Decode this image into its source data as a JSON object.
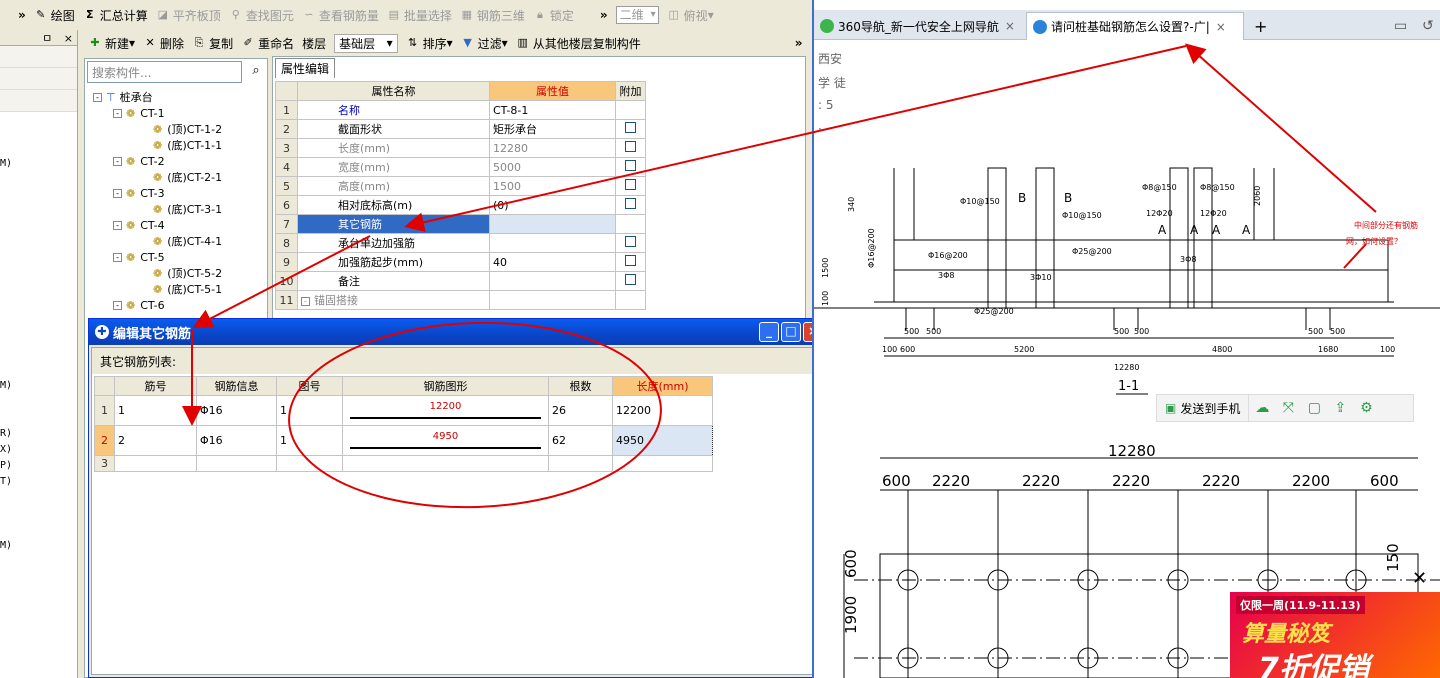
{
  "app": {
    "toolbar1": {
      "chevron": "»",
      "draw": "绘图",
      "sum": "汇总计算",
      "flat_slab": "平齐板顶",
      "find_elem": "查找图元",
      "view_rebar": "查看钢筋量",
      "batch_select": "批量选择",
      "rebar_3d": "钢筋三维",
      "lock": "锁定",
      "chevron2": "»",
      "view2d": "二维",
      "top_view": "俯视"
    },
    "toolbar2": {
      "chevron": "»",
      "new": "新建",
      "delete": "删除",
      "copy": "复制",
      "rename": "重命名",
      "floor_label": "楼层",
      "floor_value": "基础层",
      "sort": "排序",
      "filter": "过滤",
      "copy_from_floor": "从其他楼层复制构件",
      "chevron2": "»"
    },
    "left_panel": {
      "pin": "ㅁ",
      "close": "×",
      "frags": [
        "M)",
        "M)",
        "R)",
        "X)",
        "P)",
        "T)",
        "M)"
      ]
    },
    "tree": {
      "search_placeholder": "搜索构件...",
      "root": "桩承台",
      "items": [
        {
          "label": "CT-1",
          "level": 1,
          "toggle": "-"
        },
        {
          "label": "(顶)CT-1-2",
          "level": 2
        },
        {
          "label": "(底)CT-1-1",
          "level": 2
        },
        {
          "label": "CT-2",
          "level": 1,
          "toggle": "-"
        },
        {
          "label": "(底)CT-2-1",
          "level": 2
        },
        {
          "label": "CT-3",
          "level": 1,
          "toggle": "-"
        },
        {
          "label": "(底)CT-3-1",
          "level": 2
        },
        {
          "label": "CT-4",
          "level": 1,
          "toggle": "-"
        },
        {
          "label": "(底)CT-4-1",
          "level": 2
        },
        {
          "label": "CT-5",
          "level": 1,
          "toggle": "-"
        },
        {
          "label": "(顶)CT-5-2",
          "level": 2
        },
        {
          "label": "(底)CT-5-1",
          "level": 2
        },
        {
          "label": "CT-6",
          "level": 1,
          "toggle": "-"
        }
      ]
    },
    "props": {
      "tab": "属性编辑",
      "headers": [
        "属性名称",
        "属性值",
        "附加"
      ],
      "rows": [
        {
          "n": "1",
          "name": "名称",
          "value": "CT-8-1",
          "style": "blue",
          "chk": false
        },
        {
          "n": "2",
          "name": "截面形状",
          "value": "矩形承台",
          "style": "",
          "chk": true
        },
        {
          "n": "3",
          "name": "长度(mm)",
          "value": "12280",
          "style": "gray",
          "chk": true
        },
        {
          "n": "4",
          "name": "宽度(mm)",
          "value": "5000",
          "style": "gray",
          "chk": true
        },
        {
          "n": "5",
          "name": "高度(mm)",
          "value": "1500",
          "style": "gray",
          "chk": true
        },
        {
          "n": "6",
          "name": "相对底标高(m)",
          "value": "(0)",
          "style": "",
          "chk": true
        },
        {
          "n": "7",
          "name": "其它钢筋",
          "value": "",
          "style": "sel",
          "chk": false
        },
        {
          "n": "8",
          "name": "承台单边加强筋",
          "value": "",
          "style": "",
          "chk": true
        },
        {
          "n": "9",
          "name": "加强筋起步(mm)",
          "value": "40",
          "style": "",
          "chk": true
        },
        {
          "n": "10",
          "name": "备注",
          "value": "",
          "style": "",
          "chk": true
        },
        {
          "n": "11",
          "name": "锚固搭接",
          "value": "",
          "style": "group",
          "chk": false
        }
      ]
    },
    "dialog": {
      "title": "编辑其它钢筋",
      "list_label": "其它钢筋列表:",
      "headers": [
        "筋号",
        "钢筋信息",
        "图号",
        "钢筋图形",
        "根数",
        "长度(mm)"
      ],
      "rows": [
        {
          "n": "1",
          "id": "1",
          "info": "Φ16",
          "fig": "1",
          "shape": "12200",
          "count": "26",
          "length": "12200"
        },
        {
          "n": "2",
          "id": "2",
          "info": "Φ16",
          "fig": "1",
          "shape": "4950",
          "count": "62",
          "length": "4950"
        },
        {
          "n": "3",
          "id": "",
          "info": "",
          "fig": "",
          "shape": "",
          "count": "",
          "length": ""
        }
      ],
      "min": "_",
      "max": "□",
      "close": "×"
    }
  },
  "browser": {
    "tabs": [
      {
        "label": "360导航_新一代安全上网导航",
        "close": "×"
      },
      {
        "label": "请问桩基础钢筋怎么设置?-广|",
        "close": "×"
      }
    ],
    "new_tab": "+",
    "side_text": [
      "西安",
      "学 徒",
      ": 5",
      "· ·"
    ],
    "drawing": {
      "section_label": "1-1",
      "note_line1": "中间部分还有钢筋",
      "note_line2": "网，如何设置？",
      "dims_top": [
        "500",
        "500",
        "5200",
        "500",
        "500",
        "4800",
        "500",
        "500"
      ],
      "dims_bottom": [
        "100",
        "600",
        "12280",
        "1680",
        "100"
      ],
      "rebar_labels": [
        "Φ10@150",
        "Φ10@150",
        "Φ8@150",
        "Φ8@150",
        "12Φ20",
        "12Φ20",
        "Φ25@200",
        "Φ16@200",
        "Φ16@200",
        "3Φ8",
        "3Φ10",
        "3Φ8",
        "Φ25@200"
      ],
      "section_letters": [
        "B",
        "B",
        "A",
        "A",
        "A",
        "A"
      ],
      "side_dims": [
        "340",
        "2060",
        "1500",
        "100"
      ],
      "plan_total": "12280",
      "plan_dims": [
        "600",
        "2220",
        "2220",
        "2220",
        "2220",
        "2200",
        "600"
      ],
      "plan_side": [
        "600",
        "1900"
      ],
      "plan_right": "150"
    },
    "share": {
      "send": "发送到手机"
    },
    "promo": {
      "line1": "仅限一周(11.9-11.13)",
      "line2": "算量秘笈",
      "line3": "7折促销",
      "close": "✕"
    }
  },
  "colors": {
    "annotation_red": "#e00000",
    "title_blue": "#0a46c8",
    "header_orange": "#f9c77c"
  }
}
